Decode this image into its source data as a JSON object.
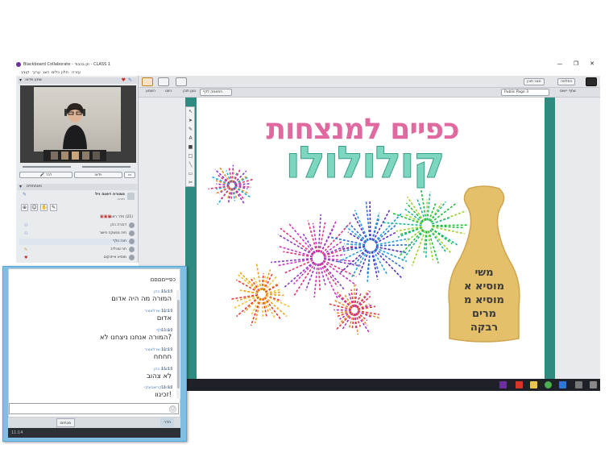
{
  "window": {
    "title": "Blackboard Collaborate - תן בכבוד - CLASS 1",
    "minimize": "—",
    "restore": "❐",
    "close": "✕"
  },
  "menu": [
    "קובץ",
    "ערוך",
    "הצג",
    "כלים",
    "חלון",
    "עזרה"
  ],
  "audio_video": {
    "header": "שמע ווידאו",
    "talk_button": "דבר",
    "video_button": "וידאו"
  },
  "participants": {
    "header": "משתתפים",
    "moderator_name": "המורה דפנה ויל",
    "moderator_role": "מנחה",
    "count_label": "(21) חדר ראשי",
    "items": [
      {
        "name": "דבורה כהן"
      },
      {
        "name": "חיה מנשקה פישר"
      },
      {
        "name": "חנה וולף"
      },
      {
        "name": "חני טוכליב"
      },
      {
        "name": "מוסיא אייזנקוט"
      }
    ]
  },
  "toolbar": {
    "help": "הסלמה",
    "follow": "מצב תוכן",
    "page_select": "Public Page 3",
    "zoom": "התאמה לדף",
    "share_app": "שתף יישום",
    "load_content": "טען תוכן",
    "explore": "ניווט",
    "bitmap": "מפה",
    "recording": "השמע"
  },
  "whiteboard": {
    "title_line1": "כפיים למנצחות",
    "title_line2": "קולולולו",
    "names": [
      "משי",
      "מוסיא א",
      "מוסיא מ",
      "מרים",
      "רבקה"
    ]
  },
  "chat": {
    "header": "כפיייםםםם",
    "messages": [
      {
        "from": "דבורה כהן",
        "text": "המורה מה היה אדום",
        "time": "11:13"
      },
      {
        "from": "רבקה שרלאציר",
        "text": "אדום",
        "time": "11:13"
      },
      {
        "from": "חנה וולף",
        "text": "?המורה אנחנו ניצחנו לא",
        "time": "11:13"
      },
      {
        "from": "רבקה שרלאציר",
        "text": "חחחח",
        "time": "11:13"
      },
      {
        "from": "דבורה כהן",
        "text": "לא צהוב",
        "time": "11:13"
      },
      {
        "from": "מרים קרשביצקי",
        "text": "!זכינוו",
        "time": "11:13"
      }
    ],
    "tab_everyone": "חדר",
    "tab_moderators": "מנחים",
    "footer_time": "11:14"
  },
  "colors": {
    "frame": "#2f8a7f",
    "title_pink": "#e06aa0",
    "title_mint": "#7dd6c0",
    "bottle": "#e5c06a",
    "chat_frame": "#7fbfe6"
  }
}
